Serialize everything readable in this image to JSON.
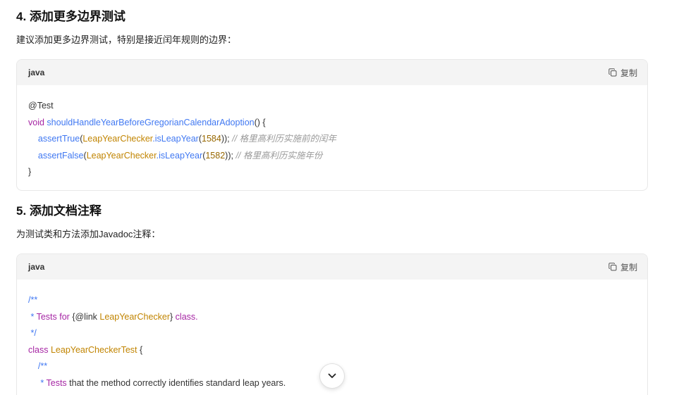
{
  "section4": {
    "heading": "4. 添加更多边界测试",
    "intro": "建议添加更多边界测试，特别是接近闰年规则的边界：",
    "code": {
      "lang": "java",
      "copy_label": "复制",
      "l1_annotation": "@Test",
      "l2_kw": "void",
      "l2_method": "shouldHandleYearBeforeGregorianCalendarAdoption",
      "l2_rest": "() {",
      "l3_assert": "assertTrue",
      "l3_class": "LeapYearChecker",
      "l3_method": ".isLeapYear",
      "l3_num": "1584",
      "l3_comment": "// 格里高利历实施前的闰年",
      "l4_assert": "assertFalse",
      "l4_class": "LeapYearChecker",
      "l4_method": ".isLeapYear",
      "l4_num": "1582",
      "l4_comment": "// 格里高利历实施年份",
      "l5_close": "}"
    }
  },
  "section5": {
    "heading": "5. 添加文档注释",
    "intro": "为测试类和方法添加Javadoc注释：",
    "code": {
      "lang": "java",
      "copy_label": "复制",
      "l1": "/**",
      "l2_star": " * ",
      "l2_text": "Tests for ",
      "l2_link": "{@link ",
      "l2_class": "LeapYearChecker",
      "l2_close": "} ",
      "l2_end": "class.",
      "l3": " */",
      "l4_kw": "class",
      "l4_class": "LeapYearCheckerTest",
      "l4_rest": " {",
      "l5": "/**",
      "l6_star": " * ",
      "l6_word": "Tests",
      "l6_rest": " that the method correctly identifies standard leap years."
    }
  },
  "scroll_down": "chevron-down-icon"
}
